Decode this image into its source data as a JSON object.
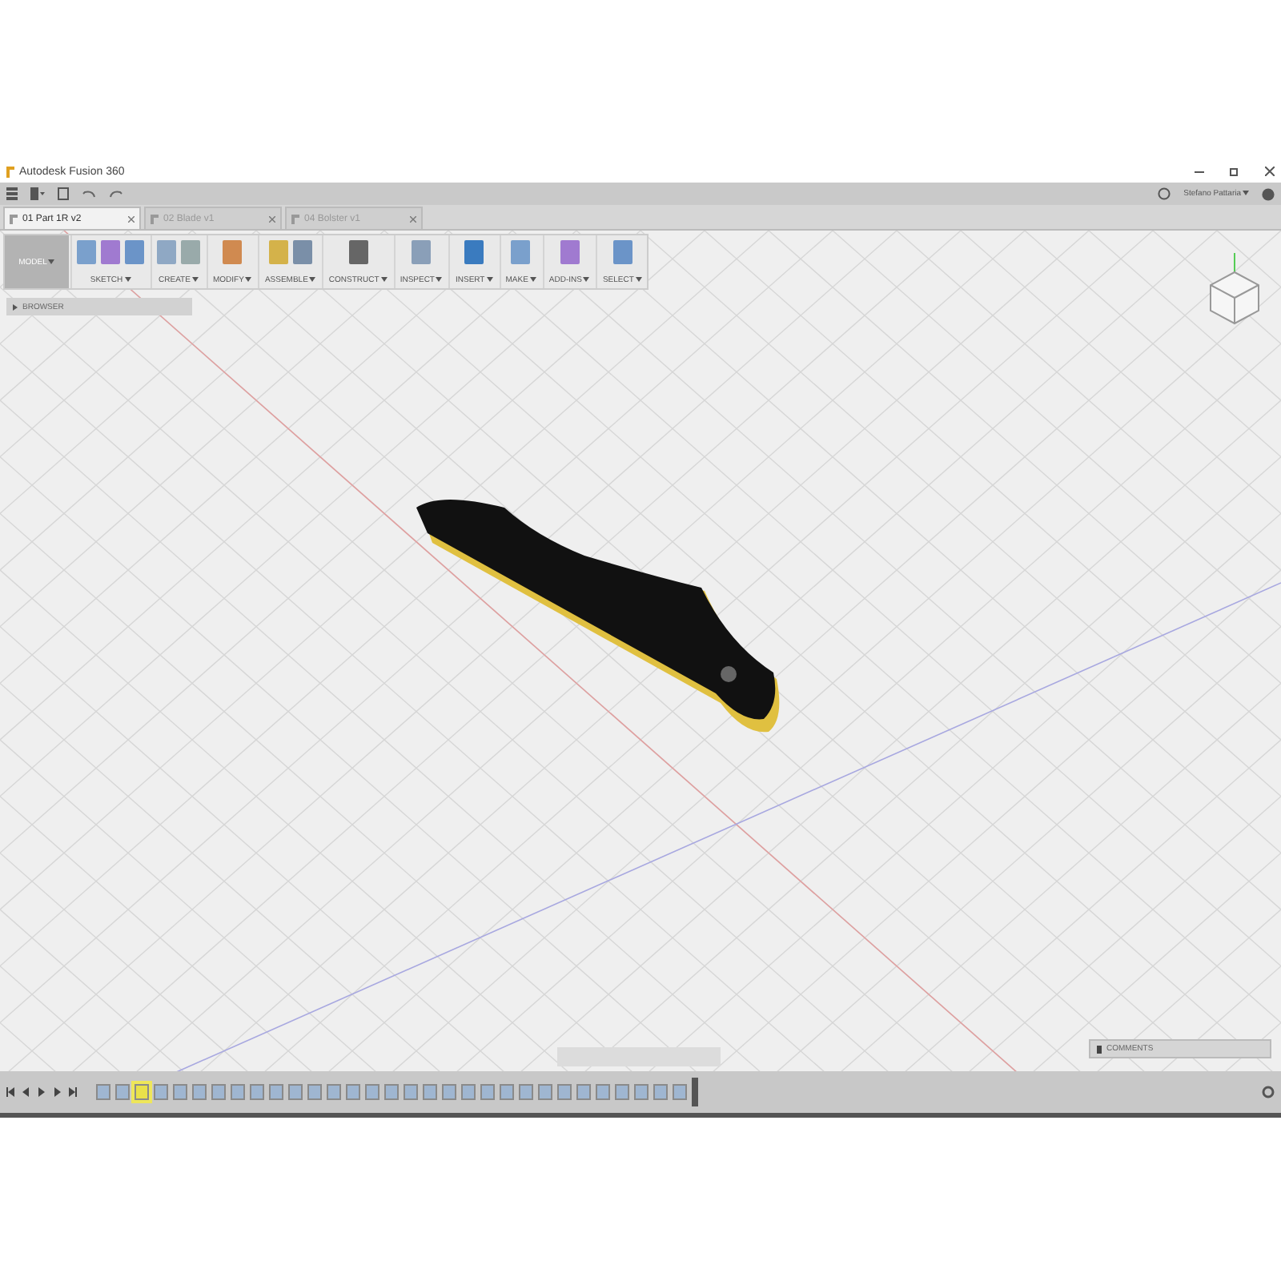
{
  "window": {
    "title": "Autodesk Fusion 360"
  },
  "quick_access": {
    "user": "Stefano Pattaria"
  },
  "tabs": [
    {
      "label": "01 Part 1R v2",
      "selected": true
    },
    {
      "label": "02 Blade v1",
      "selected": false
    },
    {
      "label": "04 Bolster v1",
      "selected": false
    }
  ],
  "workspace": {
    "label": "MODEL"
  },
  "ribbon": [
    {
      "label": "SKETCH"
    },
    {
      "label": "CREATE"
    },
    {
      "label": "MODIFY"
    },
    {
      "label": "ASSEMBLE"
    },
    {
      "label": "CONSTRUCT"
    },
    {
      "label": "INSPECT"
    },
    {
      "label": "INSERT"
    },
    {
      "label": "MAKE"
    },
    {
      "label": "ADD-INS"
    },
    {
      "label": "SELECT"
    }
  ],
  "browser": {
    "label": "BROWSER"
  },
  "comments": {
    "label": "COMMENTS"
  },
  "timeline": {
    "features": [
      {
        "selected": false
      },
      {
        "selected": false
      },
      {
        "selected": true
      },
      {
        "selected": false
      },
      {
        "selected": false
      },
      {
        "selected": false
      },
      {
        "selected": false
      },
      {
        "selected": false
      },
      {
        "selected": false
      },
      {
        "selected": false
      },
      {
        "selected": false
      },
      {
        "selected": false
      },
      {
        "selected": false
      },
      {
        "selected": false
      },
      {
        "selected": false
      },
      {
        "selected": false
      },
      {
        "selected": false
      },
      {
        "selected": false
      },
      {
        "selected": false
      },
      {
        "selected": false
      },
      {
        "selected": false
      },
      {
        "selected": false
      },
      {
        "selected": false
      },
      {
        "selected": false
      },
      {
        "selected": false
      },
      {
        "selected": false
      },
      {
        "selected": false
      },
      {
        "selected": false
      },
      {
        "selected": false
      },
      {
        "selected": false
      },
      {
        "selected": false
      }
    ]
  }
}
